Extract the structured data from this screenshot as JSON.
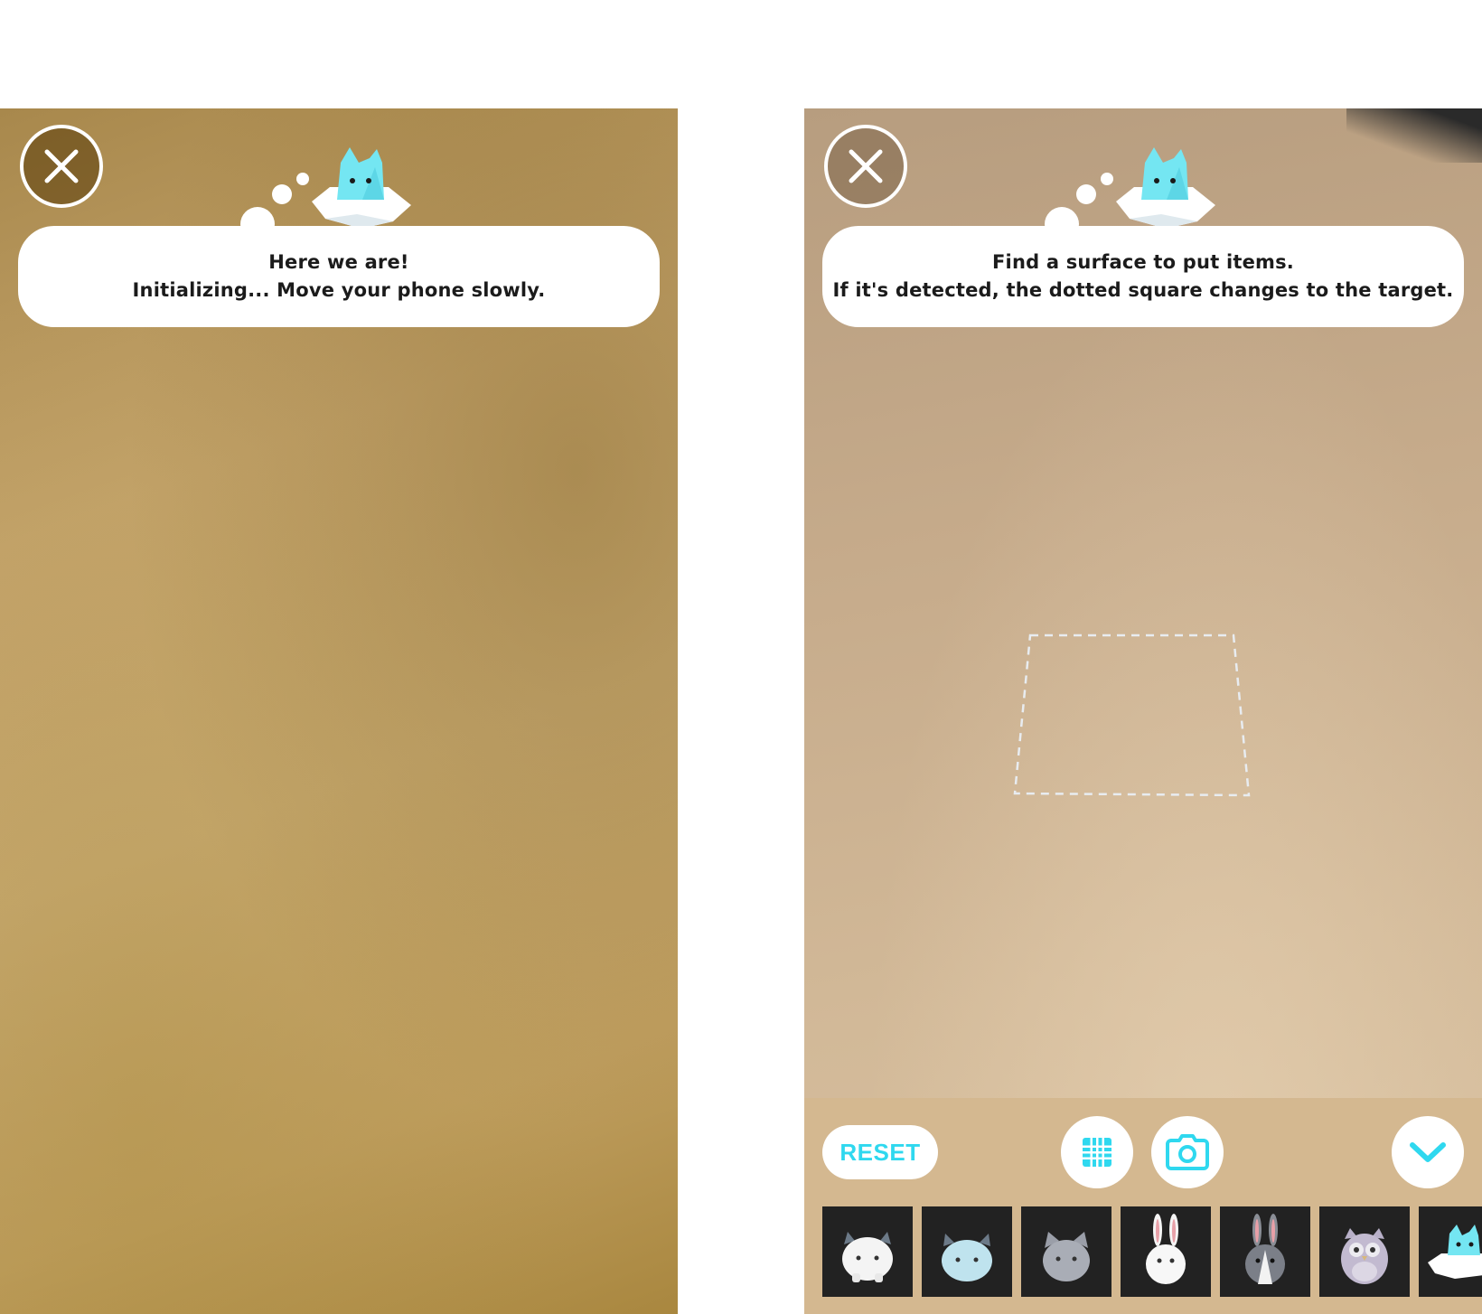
{
  "left_screen": {
    "close_icon": "close-icon",
    "message_line1": "Here we are!",
    "message_line2": "Initializing... Move your phone slowly."
  },
  "right_screen": {
    "close_icon": "close-icon",
    "message_line1": "Find a surface to put items.",
    "message_line2": "If it's detected, the dotted square changes to the target.",
    "toolbar": {
      "reset_label": "RESET",
      "grid_icon": "grid-icon",
      "camera_icon": "camera-icon",
      "collapse_icon": "chevron-down-icon"
    },
    "items": [
      {
        "name": "white-horned-creature"
      },
      {
        "name": "light-blue-horned-creature"
      },
      {
        "name": "gray-cat"
      },
      {
        "name": "white-rabbit"
      },
      {
        "name": "gray-white-rabbit"
      },
      {
        "name": "lavender-owl"
      },
      {
        "name": "cyan-cat-on-cloud"
      }
    ]
  },
  "colors": {
    "accent": "#2fd8ef",
    "bar_background": "#d4b890",
    "thumb_background": "#222222"
  }
}
